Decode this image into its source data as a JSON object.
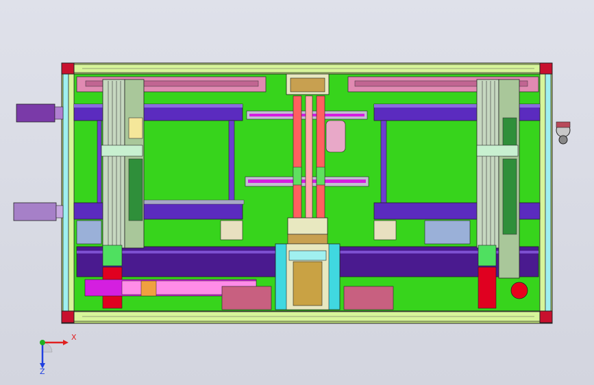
{
  "window": {
    "background": "#d9dbe4"
  },
  "colors": {
    "frame": "#c9f26c",
    "plate": "#33d41a",
    "rail": "#5b2bbf",
    "rail_dark": "#3a1585",
    "column": "#7fb39a",
    "cyan": "#3ce8f0",
    "pink": "#e18ab2",
    "red": "#e8001c",
    "magenta": "#d41fe0",
    "brown": "#c9a244",
    "motor": "#8a3cb0",
    "axis_x": "#e02020",
    "axis_y": "#20b020",
    "axis_z": "#2040e0"
  },
  "triad": {
    "x_label": "X",
    "z_label": "Z",
    "icon": "coordinate-triad-icon"
  }
}
